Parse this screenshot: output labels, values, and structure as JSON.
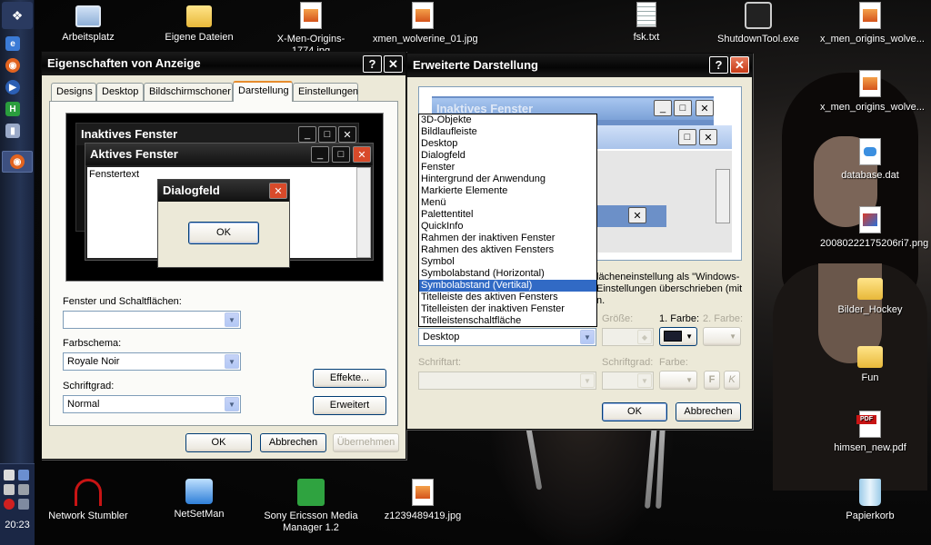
{
  "desktop": {
    "icons": [
      {
        "label": "Arbeitsplatz",
        "icon": "computer-icon"
      },
      {
        "label": "Eigene Dateien",
        "icon": "folder-documents-icon"
      },
      {
        "label": "X-Men-Origins-1774.jpg",
        "icon": "jpg-file-icon"
      },
      {
        "label": "xmen_wolverine_01.jpg",
        "icon": "jpg-file-icon"
      },
      {
        "label": "fsk.txt",
        "icon": "text-file-icon"
      },
      {
        "label": "ShutdownTool.exe",
        "icon": "exe-file-icon"
      },
      {
        "label": "x_men_origins_wolve...",
        "icon": "jpg-file-icon"
      },
      {
        "label": "x_men_origins_wolve...",
        "icon": "jpg-file-icon"
      },
      {
        "label": "database.dat",
        "icon": "dat-file-icon"
      },
      {
        "label": "20080222175206ri7.png",
        "icon": "png-file-icon"
      },
      {
        "label": "Bilder_Hockey",
        "icon": "folder-icon"
      },
      {
        "label": "Fun",
        "icon": "folder-icon"
      },
      {
        "label": "himsen_new.pdf",
        "icon": "pdf-file-icon"
      },
      {
        "label": "Network Stumbler",
        "icon": "network-stumbler-icon"
      },
      {
        "label": "NetSetMan",
        "icon": "netsetman-icon"
      },
      {
        "label": "Sony Ericsson Media Manager 1.2",
        "icon": "sony-ericsson-icon"
      },
      {
        "label": "z1239489419.jpg",
        "icon": "jpg-file-icon"
      },
      {
        "label": "Papierkorb",
        "icon": "recycle-bin-icon"
      }
    ]
  },
  "taskbar": {
    "clock": "20:23"
  },
  "display_props": {
    "title": "Eigenschaften von Anzeige",
    "help": "?",
    "close": "✕",
    "tabs": [
      "Designs",
      "Desktop",
      "Bildschirmschoner",
      "Darstellung",
      "Einstellungen"
    ],
    "active_tab": "Darstellung",
    "preview": {
      "inactive_title": "Inaktives Fenster",
      "active_title": "Aktives Fenster",
      "window_text": "Fenstertext",
      "dialog_title": "Dialogfeld",
      "dialog_ok": "OK"
    },
    "windows_buttons_label": "Fenster und Schaltflächen:",
    "windows_buttons_value": "",
    "color_scheme_label": "Farbschema:",
    "color_scheme_value": "Royale Noir",
    "font_size_label": "Schriftgrad:",
    "font_size_value": "Normal",
    "effects_button": "Effekte...",
    "advanced_button": "Erweitert",
    "ok_button": "OK",
    "cancel_button": "Abbrechen",
    "apply_button": "Übernehmen"
  },
  "advanced": {
    "title": "Erweiterte Darstellung",
    "help": "?",
    "close": "✕",
    "preview": {
      "inactive_title": "Inaktives Fenster",
      "message_partial_1": "lächeneinstellung als \"Windows-",
      "message_partial_2": "Einstellungen überschrieben (mit",
      "message_partial_3": "n."
    },
    "element_value": "Desktop",
    "size_label": "Größe:",
    "color1_label": "1. Farbe:",
    "color2_label": "2. Farbe:",
    "color1_value": "#1a1d2e",
    "font_label": "Schriftart:",
    "font_size_label": "Schriftgrad:",
    "font_color_label": "Farbe:",
    "bold_label": "F",
    "italic_label": "K",
    "ok_button": "OK",
    "cancel_button": "Abbrechen",
    "element_options": [
      "3D-Objekte",
      "Bildlaufleiste",
      "Desktop",
      "Dialogfeld",
      "Fenster",
      "Hintergrund der Anwendung",
      "Markierte Elemente",
      "Menü",
      "Palettentitel",
      "QuickInfo",
      "Rahmen der inaktiven Fenster",
      "Rahmen des aktiven Fensters",
      "Symbol",
      "Symbolabstand (Horizontal)",
      "Symbolabstand (Vertikal)",
      "Titelleiste des aktiven Fensters",
      "Titelleisten der inaktiven Fenster",
      "Titelleistenschaltfläche"
    ],
    "highlighted_option": "Symbolabstand (Vertikal)"
  }
}
